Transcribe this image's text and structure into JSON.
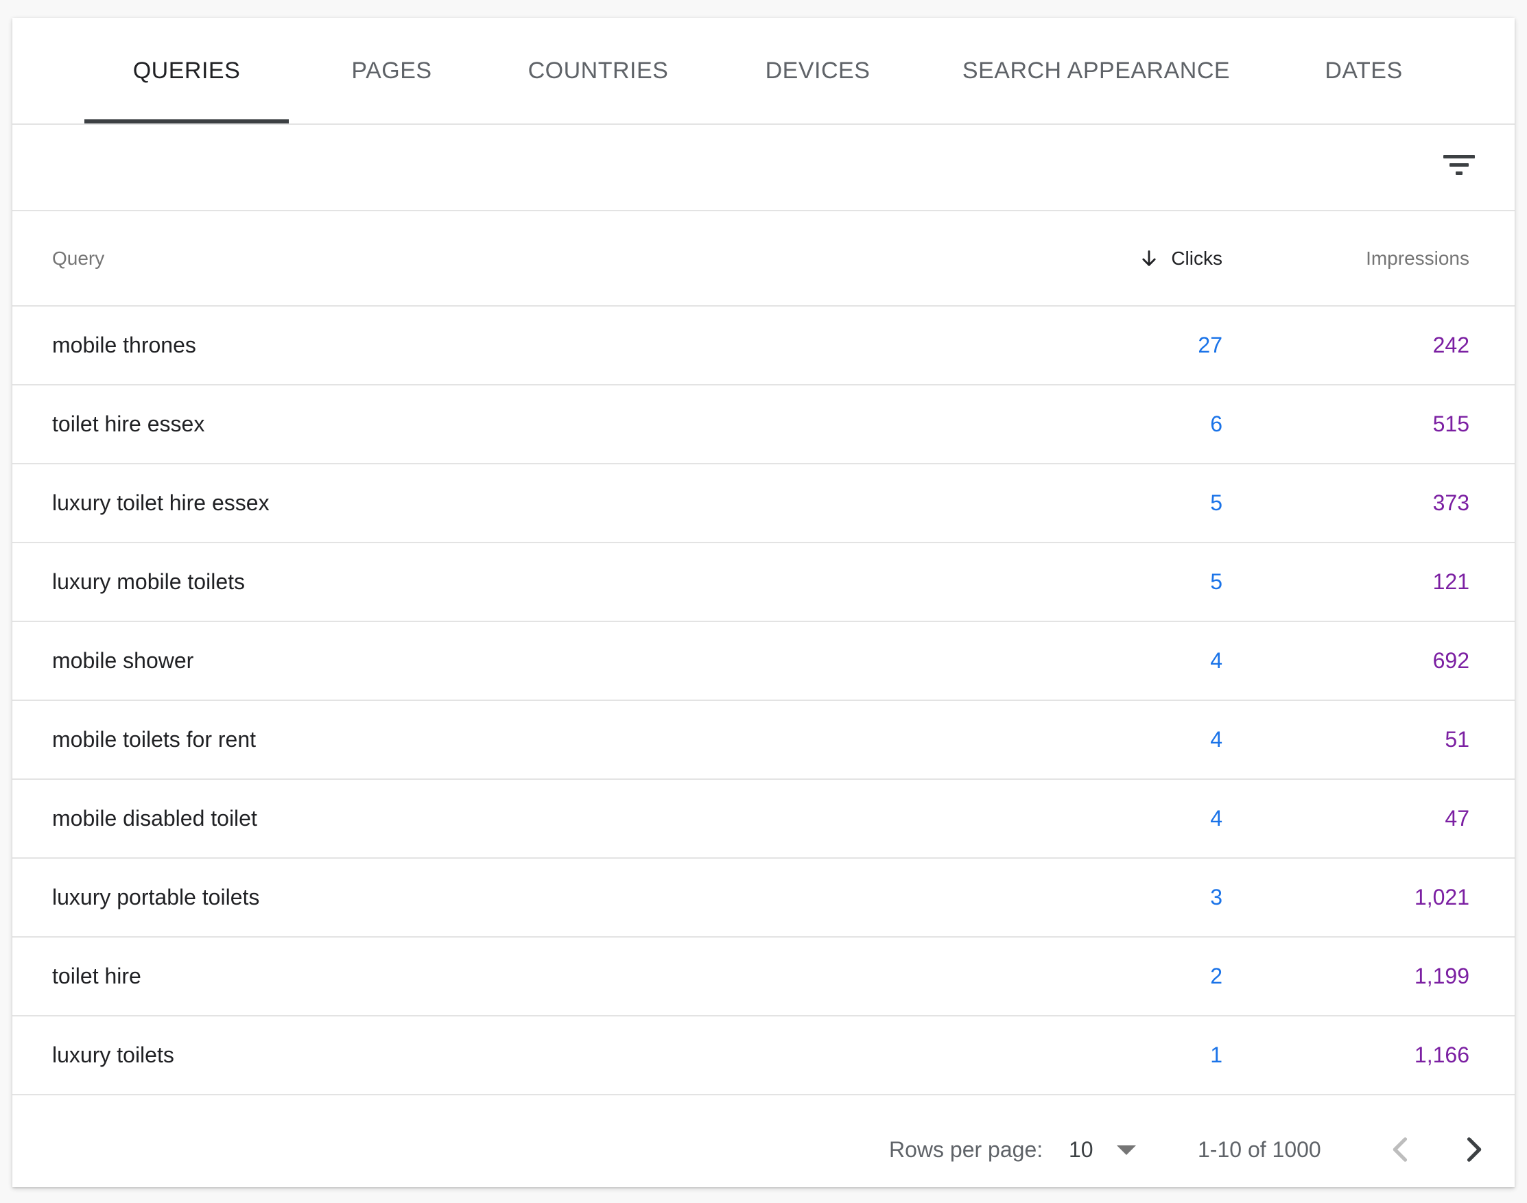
{
  "tabs": [
    {
      "label": "QUERIES",
      "active": true
    },
    {
      "label": "PAGES",
      "active": false
    },
    {
      "label": "COUNTRIES",
      "active": false
    },
    {
      "label": "DEVICES",
      "active": false
    },
    {
      "label": "SEARCH APPEARANCE",
      "active": false
    },
    {
      "label": "DATES",
      "active": false
    }
  ],
  "filter": {
    "icon": "filter-list-icon"
  },
  "table": {
    "headers": {
      "query": "Query",
      "clicks": "Clicks",
      "impressions": "Impressions",
      "sort_icon": "arrow-downward-icon"
    },
    "rows": [
      {
        "query": "mobile thrones",
        "clicks": "27",
        "impressions": "242"
      },
      {
        "query": "toilet hire essex",
        "clicks": "6",
        "impressions": "515"
      },
      {
        "query": "luxury toilet hire essex",
        "clicks": "5",
        "impressions": "373"
      },
      {
        "query": "luxury mobile toilets",
        "clicks": "5",
        "impressions": "121"
      },
      {
        "query": "mobile shower",
        "clicks": "4",
        "impressions": "692"
      },
      {
        "query": "mobile toilets for rent",
        "clicks": "4",
        "impressions": "51"
      },
      {
        "query": "mobile disabled toilet",
        "clicks": "4",
        "impressions": "47"
      },
      {
        "query": "luxury portable toilets",
        "clicks": "3",
        "impressions": "1,021"
      },
      {
        "query": "toilet hire",
        "clicks": "2",
        "impressions": "1,199"
      },
      {
        "query": "luxury toilets",
        "clicks": "1",
        "impressions": "1,166"
      }
    ]
  },
  "pagination": {
    "rows_per_page_label": "Rows per page:",
    "rows_per_page_value": "10",
    "range_text": "1-10 of 1000",
    "prev_icon": "chevron-left-icon",
    "next_icon": "chevron-right-icon"
  },
  "colors": {
    "clicks": "#1a73e8",
    "impressions": "#7b1fa2",
    "active_tab_indicator": "#3c4043"
  }
}
